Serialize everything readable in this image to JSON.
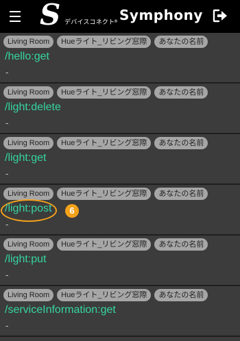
{
  "app": {
    "logo_mark": "S",
    "logo_subtitle": "デバイスコネクト",
    "logo_registered": "®",
    "logo_name": "Symphony",
    "menu_icon": "hamburger-menu-icon",
    "logout_icon": "logout-icon"
  },
  "items": [
    {
      "chips": [
        "Living Room",
        "Hueライト_リビング窓際",
        "あなたの名前"
      ],
      "endpoint": "/hello:get",
      "detail": "-"
    },
    {
      "chips": [
        "Living Room",
        "Hueライト_リビング窓際",
        "あなたの名前"
      ],
      "endpoint": "/light:delete",
      "detail": "-"
    },
    {
      "chips": [
        "Living Room",
        "Hueライト_リビング窓際",
        "あなたの名前"
      ],
      "endpoint": "/light:get",
      "detail": "-"
    },
    {
      "chips": [
        "Living Room",
        "Hueライト_リビング窓際",
        "あなたの名前"
      ],
      "endpoint": "/light:post",
      "detail": "-",
      "annotation": "6"
    },
    {
      "chips": [
        "Living Room",
        "Hueライト_リビング窓際",
        "あなたの名前"
      ],
      "endpoint": "/light:put",
      "detail": "-"
    },
    {
      "chips": [
        "Living Room",
        "Hueライト_リビング窓際",
        "あなたの名前"
      ],
      "endpoint": "/serviceInformation:get",
      "detail": "-"
    }
  ],
  "colors": {
    "background": "#3c3c3c",
    "header": "#000000",
    "chip": "#a6a6a6",
    "endpoint": "#35d6a2",
    "annotation": "#f4a21b"
  }
}
